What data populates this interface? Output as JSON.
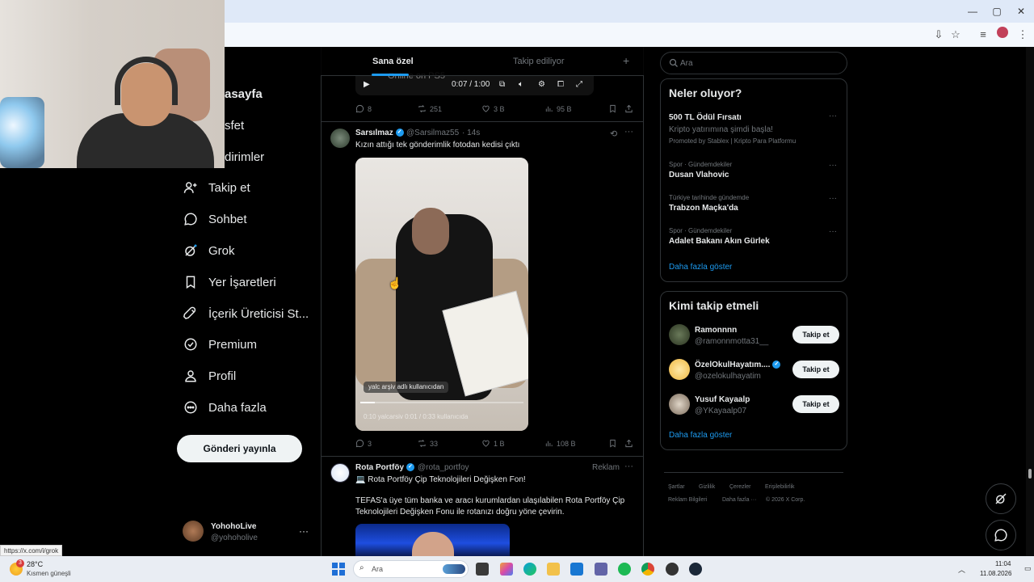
{
  "browser": {
    "window_controls": [
      "—",
      "▢",
      "✕"
    ],
    "status_url": "https://x.com/i/grok"
  },
  "nav": {
    "partial_items": [
      "asayfa",
      "sfet",
      "dirimler"
    ],
    "items": [
      {
        "label": "Takip et",
        "icon": "add-person-icon"
      },
      {
        "label": "Sohbet",
        "icon": "chat-bubble-icon"
      },
      {
        "label": "Grok",
        "icon": "grok-icon"
      },
      {
        "label": "Yer İşaretleri",
        "icon": "bookmark-icon"
      },
      {
        "label": "İçerik Üreticisi St...",
        "icon": "rocket-icon"
      },
      {
        "label": "Premium",
        "icon": "verified-check-icon"
      },
      {
        "label": "Profil",
        "icon": "person-icon"
      },
      {
        "label": "Daha fazla",
        "icon": "more-circle-icon"
      }
    ],
    "post_button": "Gönderi yayınla",
    "profile": {
      "name": "YohohoLive",
      "handle": "@yohoholive",
      "more": "···"
    }
  },
  "tabs": {
    "active": "Sana özel",
    "inactive": "Takip ediliyor",
    "add": "+"
  },
  "top_video": {
    "overlay_text": "Online on PS5",
    "time": "0:07 / 1:00"
  },
  "top_actions": {
    "replies": "8",
    "reposts": "251",
    "likes": "3 B",
    "views": "95 B"
  },
  "tweet1": {
    "name": "Sarsılmaz",
    "handle": "@Sarsilmaz55",
    "time": "· 14s",
    "text": "Kızın attığı tek gönderimlik fotodan kedisi çıktı",
    "video_label": "yalc arşiv adlı kullanıcıdan",
    "video_controls": "0:10   yalcarsiv  0:01 / 0:33 kullanıcıda",
    "progress": 0.09,
    "actions": {
      "replies": "3",
      "reposts": "33",
      "likes": "1 B",
      "views": "108 B"
    }
  },
  "tweet2": {
    "name": "Rota Portföy",
    "handle": "@rota_portfoy",
    "ad_label": "Reklam",
    "headline": "💻 Rota Portföy Çip Teknolojileri Değişken Fon!",
    "body": "TEFAS'a üye tüm banka ve aracı kurumlardan ulaşılabilen Rota Portföy Çip Teknolojileri Değişken Fonu ile rotanızı doğru yöne çevirin."
  },
  "search": {
    "placeholder": "Ara"
  },
  "trends": {
    "title": "Neler oluyor?",
    "promo": {
      "name": "500 TL Ödül Fırsatı",
      "sub": "Kripto yatırımına şimdi başla!",
      "promoted": "Promoted by Stablex | Kripto Para Platformu"
    },
    "items": [
      {
        "category": "Spor · Gündemdekiler",
        "name": "Dusan Vlahovic"
      },
      {
        "category": "Türkiye tarihinde gündemde",
        "name": "Trabzon Maçka'da"
      },
      {
        "category": "Spor · Gündemdekiler",
        "name": "Adalet Bakanı Akın Gürlek"
      }
    ],
    "show_more": "Daha fazla göster"
  },
  "who_to_follow": {
    "title": "Kimi takip etmeli",
    "follow_label": "Takip et",
    "users": [
      {
        "name": "Ramonnnn",
        "handle": "@ramonnmotta31__"
      },
      {
        "name": "ÖzelOkulHayatım....",
        "handle": "@ozelokulhayatim"
      },
      {
        "name": "Yusuf Kayaalp",
        "handle": "@YKayaalp07"
      }
    ],
    "show_more": "Daha fazla göster"
  },
  "footer": {
    "row1": [
      "Şartlar",
      "Gizlilik",
      "Çerezler",
      "Erişilebilirlik"
    ],
    "row2": [
      "Reklam Bilgileri",
      "Daha fazla ···",
      "© 2026 X Corp."
    ]
  },
  "taskbar": {
    "weather_badge": "3",
    "temperature": "28°C",
    "weather": "Kısmen güneşli",
    "search_placeholder": "Ara",
    "time": "11:04",
    "date": "11.08.2026"
  },
  "colors": {
    "accent": "#1d9bf0",
    "background": "#000000",
    "border": "#2f3336",
    "muted": "#71767b"
  }
}
